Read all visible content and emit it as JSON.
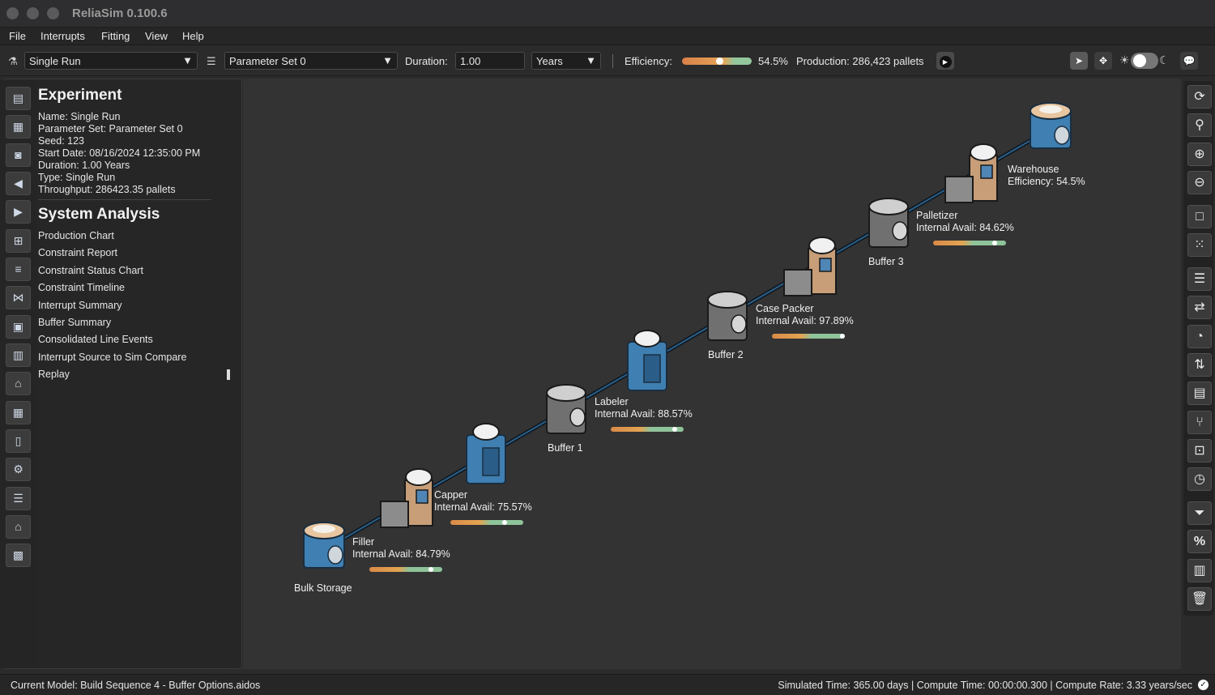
{
  "window": {
    "title": "ReliaSim 0.100.6"
  },
  "menu": [
    "File",
    "Interrupts",
    "Fitting",
    "View",
    "Help"
  ],
  "toolbar": {
    "experiment": "Single Run",
    "parameter_set": "Parameter Set 0",
    "duration_label": "Duration:",
    "duration_value": "1.00",
    "duration_unit": "Years",
    "efficiency_label": "Efficiency:",
    "efficiency_value": "54.5%",
    "efficiency_fraction": 0.545,
    "production_text": "Production: 286,423 pallets"
  },
  "experiment": {
    "title": "Experiment",
    "lines": [
      "Name: Single Run",
      "Parameter Set: Parameter Set 0",
      "Seed: 123",
      "Start Date: 08/16/2024 12:35:00 PM",
      "Duration: 1.00 Years",
      "Type: Single Run",
      "Throughput: 286423.35 pallets"
    ]
  },
  "analysis": {
    "title": "System Analysis",
    "items": [
      "Production Chart",
      "Constraint Report",
      "Constraint Status Chart",
      "Constraint Timeline",
      "Interrupt Summary",
      "Buffer Summary",
      "Consolidated Line Events",
      "Interrupt Source to Sim Compare",
      "Replay"
    ]
  },
  "nodes": {
    "bulk_storage": "Bulk Storage",
    "filler": {
      "name": "Filler",
      "avail": "Internal Avail: 84.79%"
    },
    "capper": {
      "name": "Capper",
      "avail": "Internal Avail: 75.57%"
    },
    "buffer1": "Buffer 1",
    "labeler": {
      "name": "Labeler",
      "avail": "Internal Avail: 88.57%"
    },
    "buffer2": "Buffer 2",
    "case_packer": {
      "name": "Case Packer",
      "avail": "Internal Avail: 97.89%"
    },
    "buffer3": "Buffer 3",
    "palletizer": {
      "name": "Palletizer",
      "avail": "Internal Avail: 84.62%"
    },
    "warehouse": {
      "name": "Warehouse",
      "efficiency": "Efficiency: 54.5%"
    }
  },
  "status": {
    "model": "Current Model: Build Sequence 4 - Buffer Options.aidos",
    "right": "Simulated Time: 365.00 days | Compute Time: 00:00:00.300 | Compute Rate: 3.33 years/sec"
  }
}
